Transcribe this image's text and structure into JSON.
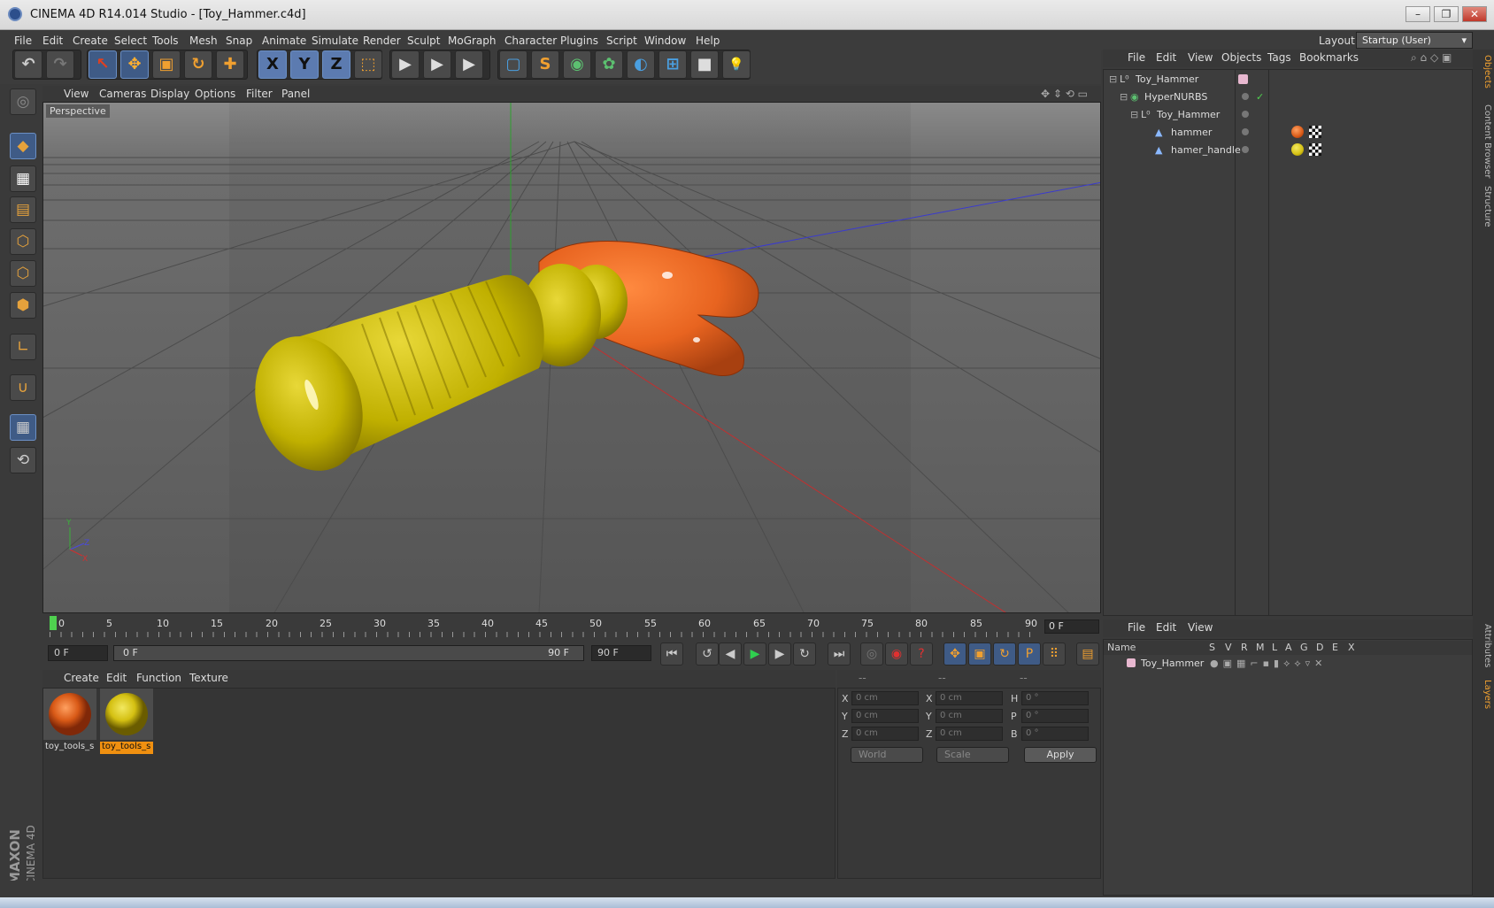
{
  "window": {
    "title": "CINEMA 4D R14.014 Studio - [Toy_Hammer.c4d]",
    "min": "–",
    "max": "❐",
    "close": "✕"
  },
  "menu": [
    "File",
    "Edit",
    "Create",
    "Select",
    "Tools",
    "Mesh",
    "Snap",
    "Animate",
    "Simulate",
    "Render",
    "Sculpt",
    "MoGraph",
    "Character",
    "Plugins",
    "Script",
    "Window",
    "Help"
  ],
  "layout": {
    "label": "Layout:",
    "value": "Startup (User)"
  },
  "toolbar": {
    "undo": "↶",
    "redo": "↷",
    "tools": [
      "↖",
      "✥",
      "▣",
      "↻",
      "✚"
    ],
    "axes": [
      "X",
      "Y",
      "Z"
    ],
    "coord": "⬚",
    "render": [
      "▶",
      "▶",
      "▶"
    ],
    "create": [
      "▢",
      "S",
      "◉",
      "✿",
      "◐",
      "⊞",
      "■",
      "💡"
    ]
  },
  "viewport": {
    "menu": [
      "View",
      "Cameras",
      "Display",
      "Options",
      "Filter",
      "Panel"
    ],
    "label": "Perspective",
    "axis_y": "Y",
    "axis_z": "Z",
    "axis_x": "X"
  },
  "timeline": {
    "ticks": [
      "0",
      "5",
      "10",
      "15",
      "20",
      "25",
      "30",
      "35",
      "40",
      "45",
      "50",
      "55",
      "60",
      "65",
      "70",
      "75",
      "80",
      "85",
      "90"
    ],
    "current_frame": "0 F",
    "start": "0 F",
    "range_start": "0 F",
    "range_end": "90 F",
    "end": "90 F"
  },
  "materials": {
    "menu": [
      "Create",
      "Edit",
      "Function",
      "Texture"
    ],
    "items": [
      {
        "label": "toy_tools_s",
        "color": "#d95a17",
        "selected": false
      },
      {
        "label": "toy_tools_s",
        "color": "#d4c012",
        "selected": true
      }
    ]
  },
  "coordinates": {
    "headers": [
      "--",
      "--",
      "--"
    ],
    "rows": [
      {
        "a": "X",
        "av": "0 cm",
        "b": "X",
        "bv": "0 cm",
        "c": "H",
        "cv": "0 °"
      },
      {
        "a": "Y",
        "av": "0 cm",
        "b": "Y",
        "bv": "0 cm",
        "c": "P",
        "cv": "0 °"
      },
      {
        "a": "Z",
        "av": "0 cm",
        "b": "Z",
        "bv": "0 cm",
        "c": "B",
        "cv": "0 °"
      }
    ],
    "mode": "World",
    "transform": "Scale",
    "apply": "Apply"
  },
  "objects": {
    "menu": [
      "File",
      "Edit",
      "View",
      "Objects",
      "Tags",
      "Bookmarks"
    ],
    "items": [
      {
        "name": "Toy_Hammer",
        "indent": 0
      },
      {
        "name": "HyperNURBS",
        "indent": 1
      },
      {
        "name": "Toy_Hammer",
        "indent": 2
      },
      {
        "name": "hammer",
        "indent": 3
      },
      {
        "name": "hamer_handle",
        "indent": 3
      }
    ]
  },
  "layers": {
    "menu": [
      "File",
      "Edit",
      "View"
    ],
    "columns": [
      "Name",
      "S",
      "V",
      "R",
      "M",
      "L",
      "A",
      "G",
      "D",
      "E",
      "X"
    ],
    "items": [
      {
        "name": "Toy_Hammer"
      }
    ]
  },
  "right_tabs": [
    "Objects",
    "Content Browser",
    "Structure",
    "Attributes",
    "Layers"
  ],
  "brand": {
    "line1": "MAXON",
    "line2": "CINEMA 4D"
  }
}
